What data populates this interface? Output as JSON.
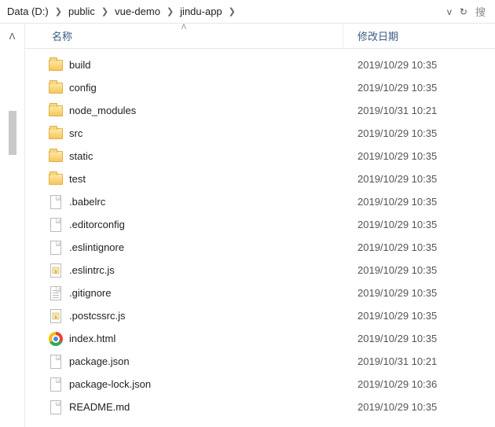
{
  "breadcrumbs": [
    "Data (D:)",
    "public",
    "vue-demo",
    "jindu-app"
  ],
  "search_placeholder": "搜",
  "columns": {
    "name": "名称",
    "date": "修改日期"
  },
  "items": [
    {
      "name": "build",
      "date": "2019/10/29 10:35",
      "type": "folder"
    },
    {
      "name": "config",
      "date": "2019/10/29 10:35",
      "type": "folder"
    },
    {
      "name": "node_modules",
      "date": "2019/10/31 10:21",
      "type": "folder"
    },
    {
      "name": "src",
      "date": "2019/10/29 10:35",
      "type": "folder"
    },
    {
      "name": "static",
      "date": "2019/10/29 10:35",
      "type": "folder"
    },
    {
      "name": "test",
      "date": "2019/10/29 10:35",
      "type": "folder"
    },
    {
      "name": ".babelrc",
      "date": "2019/10/29 10:35",
      "type": "file"
    },
    {
      "name": ".editorconfig",
      "date": "2019/10/29 10:35",
      "type": "file"
    },
    {
      "name": ".eslintignore",
      "date": "2019/10/29 10:35",
      "type": "file"
    },
    {
      "name": ".eslintrc.js",
      "date": "2019/10/29 10:35",
      "type": "js"
    },
    {
      "name": ".gitignore",
      "date": "2019/10/29 10:35",
      "type": "text"
    },
    {
      "name": ".postcssrc.js",
      "date": "2019/10/29 10:35",
      "type": "js"
    },
    {
      "name": "index.html",
      "date": "2019/10/29 10:35",
      "type": "chrome"
    },
    {
      "name": "package.json",
      "date": "2019/10/31 10:21",
      "type": "file"
    },
    {
      "name": "package-lock.json",
      "date": "2019/10/29 10:36",
      "type": "file"
    },
    {
      "name": "README.md",
      "date": "2019/10/29 10:35",
      "type": "file"
    }
  ]
}
